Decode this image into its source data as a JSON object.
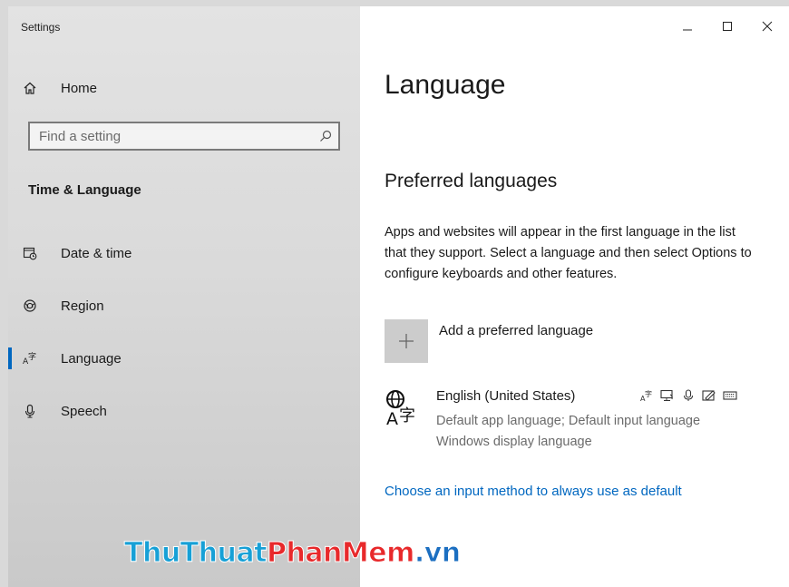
{
  "window": {
    "app_title": "Settings",
    "controls": {
      "minimize": "—",
      "maximize": "☐",
      "close": "✕"
    }
  },
  "sidebar": {
    "home_label": "Home",
    "search_placeholder": "Find a setting",
    "section_title": "Time & Language",
    "items": [
      {
        "label": "Date & time",
        "icon": "calendar-clock-icon",
        "active": false
      },
      {
        "label": "Region",
        "icon": "globe-region-icon",
        "active": false
      },
      {
        "label": "Language",
        "icon": "language-icon",
        "active": true
      },
      {
        "label": "Speech",
        "icon": "microphone-icon",
        "active": false
      }
    ]
  },
  "main": {
    "title": "Language",
    "preferred": {
      "heading": "Preferred languages",
      "description": "Apps and websites will appear in the first language in the list that they support. Select a language and then select Options to configure keyboards and other features.",
      "add_label": "Add a preferred language",
      "languages": [
        {
          "name": "English (United States)",
          "detail_line1": "Default app language; Default input language",
          "detail_line2": "Windows display language",
          "feature_icons": [
            "display-language-icon",
            "text-to-speech-icon",
            "speech-recognition-icon",
            "handwriting-icon",
            "keyboard-icon"
          ]
        }
      ]
    },
    "link_input_method": "Choose an input method to always use as default"
  },
  "watermark": {
    "part1": "ThuThuat",
    "part2": "PhanMem",
    "part3": ".vn"
  },
  "colors": {
    "accent": "#0067c0",
    "sidebar_bg": "#dcdcdc",
    "add_button_bg": "#cccccc"
  }
}
